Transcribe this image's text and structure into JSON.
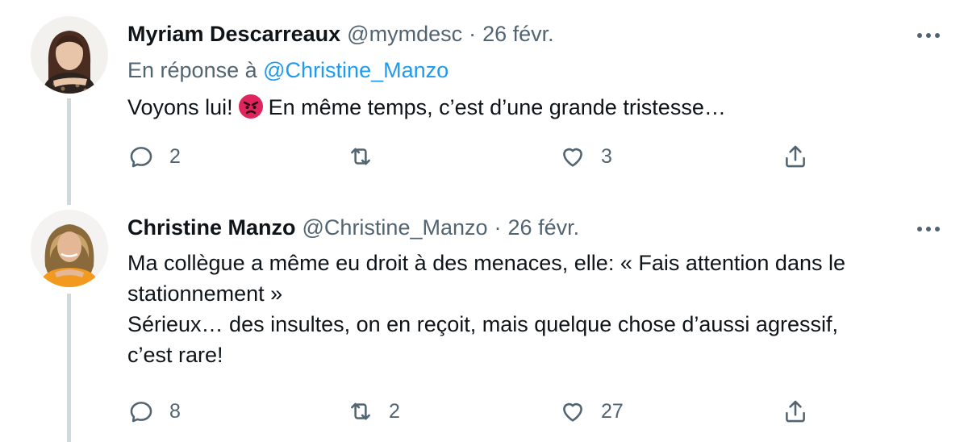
{
  "tweets": [
    {
      "name": "Myriam Descarreaux",
      "handle": "@mymdesc",
      "separator": "·",
      "date": "26 févr.",
      "reply_prefix": "En réponse à",
      "reply_mention": "@Christine_Manzo",
      "text_before_emoji": "Voyons lui!",
      "emoji": "angry-face-icon",
      "text_after_emoji": "En même temps, c’est d’une grande tristesse…",
      "replies": "2",
      "retweets": "",
      "likes": "3"
    },
    {
      "name": "Christine Manzo",
      "handle": "@Christine_Manzo",
      "separator": "·",
      "date": "26 févr.",
      "text_lines": [
        "Ma collègue a même eu droit à des menaces, elle: « Fais attention dans le",
        "stationnement »",
        "Sérieux… des insultes, on en reçoit, mais quelque chose d’aussi agressif,",
        "c’est rare!"
      ],
      "replies": "8",
      "retweets": "2",
      "likes": "27"
    }
  ],
  "colors": {
    "text": "#0f1419",
    "secondary": "#536471",
    "link": "#1d9bf0",
    "thread_line": "#cfd9de"
  }
}
